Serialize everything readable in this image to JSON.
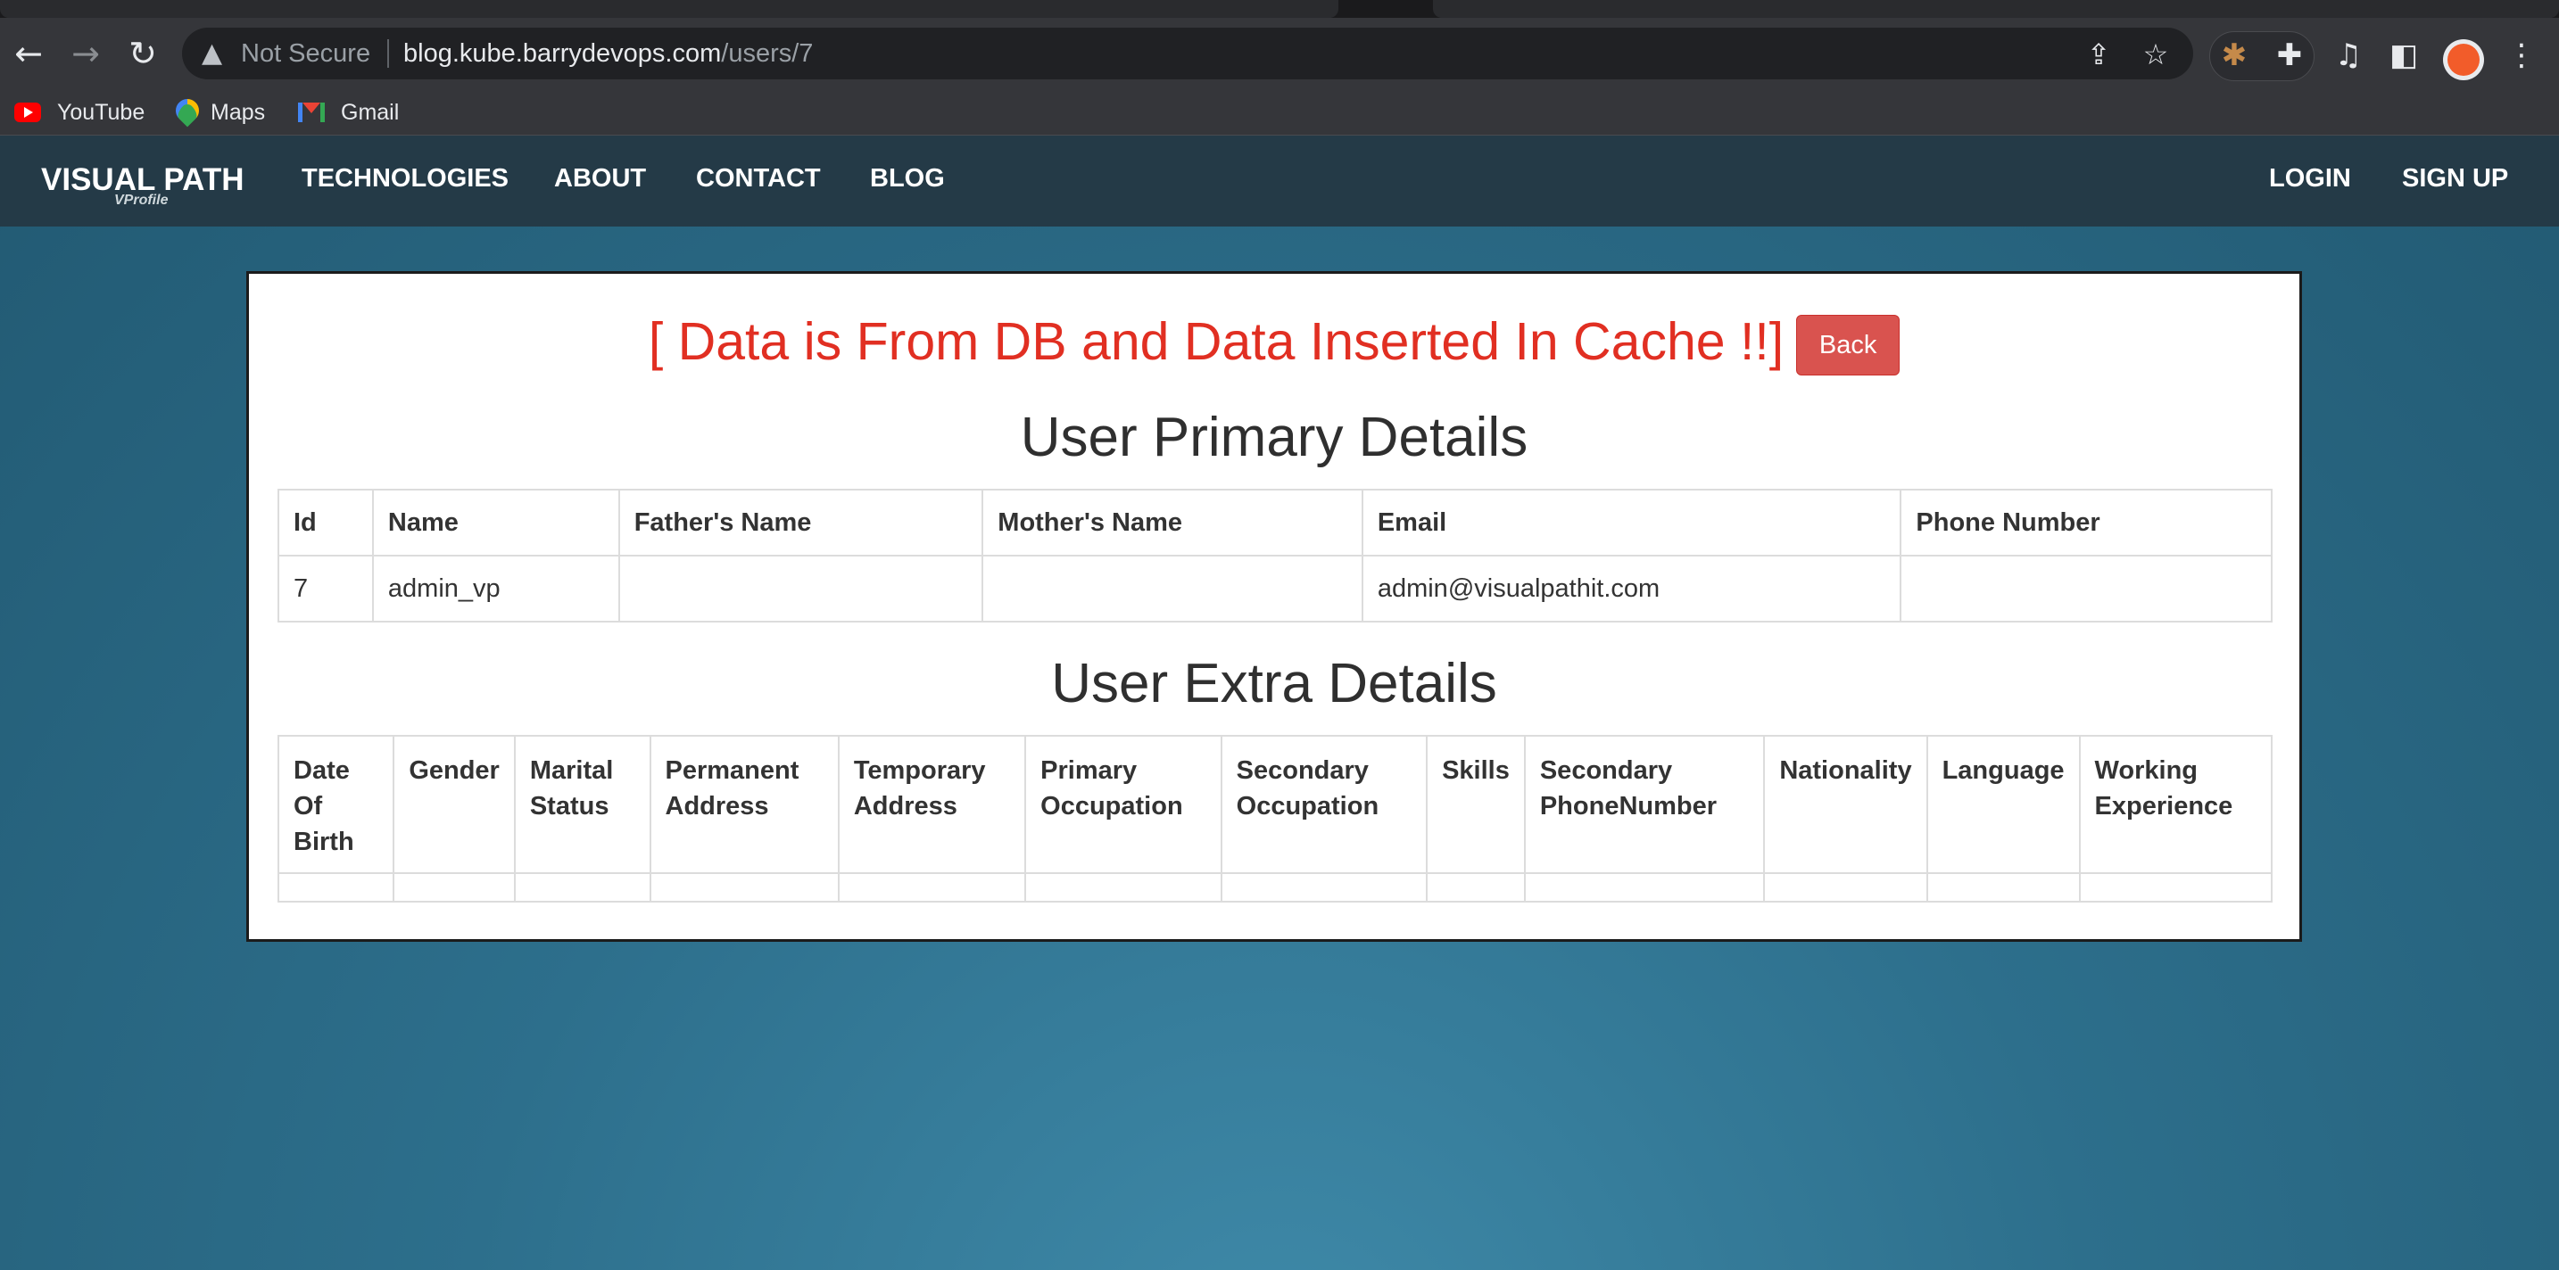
{
  "browser": {
    "address_security": "Not Secure",
    "url_host": "blog.kube.barrydevops.com",
    "url_path": "/users/7",
    "bookmarks": [
      {
        "label": "YouTube",
        "icon": "youtube-icon"
      },
      {
        "label": "Maps",
        "icon": "maps-icon"
      },
      {
        "label": "Gmail",
        "icon": "gmail-icon"
      }
    ]
  },
  "site": {
    "brand": "VISUAL PATH",
    "brand_sub": "VProfile",
    "nav": [
      "TECHNOLOGIES",
      "ABOUT",
      "CONTACT",
      "BLOG"
    ],
    "login": "LOGIN",
    "signup": "SIGN UP"
  },
  "main": {
    "message": "[ Data is From DB and Data Inserted In Cache !!]",
    "back_label": "Back",
    "primary_title": "User Primary Details",
    "primary_headers": [
      "Id",
      "Name",
      "Father's Name",
      "Mother's Name",
      "Email",
      "Phone Number"
    ],
    "primary_row": [
      "7",
      "admin_vp",
      "",
      "",
      "admin@visualpathit.com",
      ""
    ],
    "extra_title": "User Extra Details",
    "extra_headers": [
      "Date Of Birth",
      "Gender",
      "Marital Status",
      "Permanent Address",
      "Temporary Address",
      "Primary Occupation",
      "Secondary Occupation",
      "Skills",
      "Secondary PhoneNumber",
      "Nationality",
      "Language",
      "Working Experience"
    ],
    "extra_row": [
      "",
      "",
      "",
      "",
      "",
      "",
      "",
      "",
      "",
      "",
      "",
      ""
    ]
  },
  "colors": {
    "message": "#e12f22",
    "back_button": "#d9534f",
    "navbar": "#243a47",
    "background": "#2d6f8c"
  }
}
